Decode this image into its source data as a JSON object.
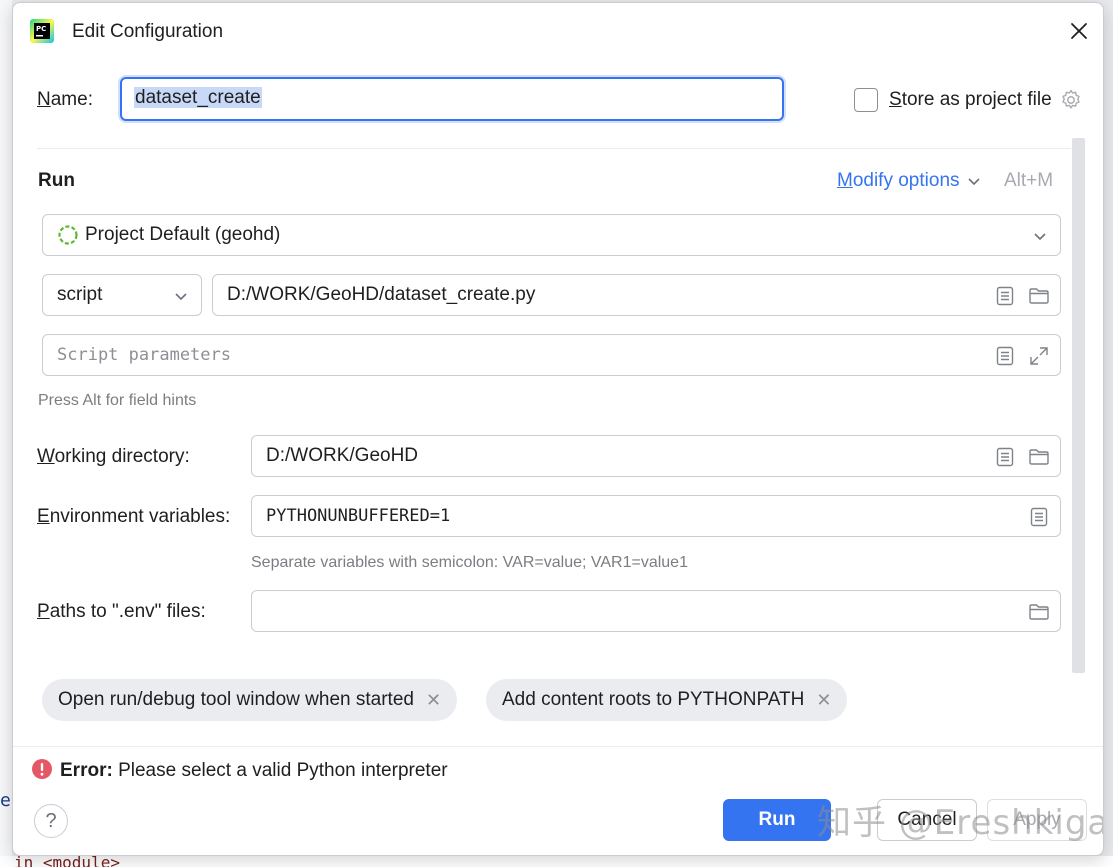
{
  "dialog": {
    "title": "Edit Configuration",
    "close_icon": "close-icon",
    "app_icon": "pycharm-logo-icon"
  },
  "name_row": {
    "label": "Name:",
    "label_mnemonic": "N",
    "label_rest": "ame:",
    "value": "dataset_create",
    "store_label_mnemonic": "S",
    "store_label_rest": "tore as project file",
    "store_checked": false
  },
  "run_section": {
    "heading": "Run",
    "modify_mnemonic": "M",
    "modify_rest": "odify options",
    "modify_shortcut": "Alt+M",
    "interpreter": "Project Default (geohd)",
    "target_type": "script",
    "script_path": "D:/WORK/GeoHD/dataset_create.py",
    "script_params_placeholder": "Script parameters",
    "hint": "Press Alt for field hints"
  },
  "working_dir": {
    "label_mnemonic": "W",
    "label_rest": "orking directory:",
    "value": "D:/WORK/GeoHD"
  },
  "env_vars": {
    "label_mnemonic": "E",
    "label_rest": "nvironment variables:",
    "value": "PYTHONUNBUFFERED=1",
    "hint": "Separate variables with semicolon: VAR=value; VAR1=value1"
  },
  "env_files": {
    "label_mnemonic": "P",
    "label_rest": "aths to \".env\" files:",
    "value": ""
  },
  "chips": [
    {
      "label": "Open run/debug tool window when started"
    },
    {
      "label": "Add content roots to PYTHONPATH"
    }
  ],
  "error": {
    "prefix": "Error:",
    "message": " Please select a valid Python interpreter"
  },
  "buttons": {
    "run": "Run",
    "cancel": "Cancel",
    "apply": "Apply",
    "help": "?"
  },
  "watermark": "知乎 @Ereshkigal",
  "background": {
    "code_line_1": "e",
    "code_line_2": "in <module>"
  },
  "colors": {
    "accent": "#3574f0",
    "error": "#e55765",
    "interpreter_ring": "#5fb832"
  }
}
